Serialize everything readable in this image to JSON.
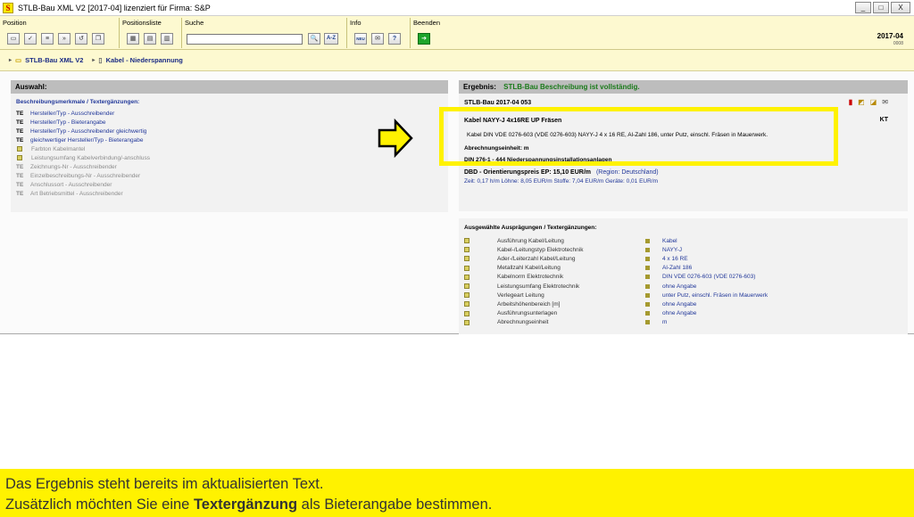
{
  "window": {
    "title": "STLB-Bau XML V2 [2017-04] lizenziert für Firma: S&P",
    "app_icon": "S",
    "buttons": [
      "_",
      "□",
      "X"
    ]
  },
  "toolbar": {
    "groups": [
      {
        "label": "Position",
        "buttons": [
          "new-doc-icon",
          "check-icon",
          "list-icon",
          "forward-icon",
          "undo-icon",
          "copy-icon"
        ]
      },
      {
        "label": "Positionsliste",
        "buttons": [
          "list-add-icon",
          "list-edit-icon",
          "list-copy-icon"
        ]
      },
      {
        "label": "Suche",
        "search_value": "",
        "binoculars": "🔍",
        "az": "A-Z"
      },
      {
        "label": "Info",
        "neu": "NEU",
        "mail": "✉",
        "help": "?"
      },
      {
        "label": "Beenden",
        "exit": "exit-icon"
      }
    ],
    "version": "2017-04",
    "version_sub": "0008"
  },
  "breadcrumb": {
    "items": [
      "STLB-Bau XML V2",
      "Kabel - Niederspannung"
    ]
  },
  "auswahl": {
    "header": "Auswahl:",
    "section_head": "Beschreibungsmerkmale / Textergänzungen:",
    "items": [
      {
        "tag": "TE",
        "text": "Hersteller/Typ - Ausschreibender",
        "muted": false
      },
      {
        "tag": "TE",
        "text": "Hersteller/Typ - Bieterangabe",
        "muted": false
      },
      {
        "tag": "TE",
        "text": "Hersteller/Typ - Ausschreibender gleichwertig",
        "muted": false
      },
      {
        "tag": "TE",
        "text": "gleichwertiger Hersteller/Typ - Bieterangabe",
        "muted": false
      },
      {
        "tag": "",
        "text": "Farbton Kabelmantel",
        "muted": true
      },
      {
        "tag": "",
        "text": "Leistungsumfang Kabelverbindung/-anschluss",
        "muted": true
      },
      {
        "tag": "TE",
        "text": "Zeichnungs-Nr - Ausschreibender",
        "muted": true
      },
      {
        "tag": "TE",
        "text": "Einzelbeschreibungs-Nr - Ausschreibender",
        "muted": true
      },
      {
        "tag": "TE",
        "text": "Anschlussort - Ausschreibender",
        "muted": true
      },
      {
        "tag": "TE",
        "text": "Art Betriebsmittel - Ausschreibender",
        "muted": true
      }
    ]
  },
  "ergebnis": {
    "label": "Ergebnis:",
    "status": "STLB-Bau Beschreibung ist vollständig.",
    "code": "STLB-Bau 2017-04 053",
    "kt": "KT",
    "kurztext": "Kabel NAYY-J 4x16RE UP Fräsen",
    "langtext": "Kabel DIN VDE 0276-603 (VDE 0276-603) NAYY-J 4 x 16 RE, Al-Zahl 186, unter Putz, einschl. Fräsen in Mauerwerk.",
    "einheit": "Abrechnungseinheit: m",
    "din": "DIN 276-1 - 444 Niederspannungsinstallationsanlagen",
    "price": "DBD - Orientierungspreis EP: 15,10 EUR/m",
    "region": "(Region: Deutschland)",
    "price_sub": "Zeit: 0,17 h/m   Löhne: 8,05 EUR/m   Stoffe: 7,04 EUR/m   Geräte: 0,01 EUR/m"
  },
  "auspraegungen": {
    "head": "Ausgewählte Ausprägungen / Textergänzungen:",
    "rows": [
      {
        "name": "Ausführung Kabel/Leitung",
        "value": "Kabel"
      },
      {
        "name": "Kabel-/Leitungstyp Elektrotechnik",
        "value": "NAYY-J"
      },
      {
        "name": "Ader-/Leiterzahl Kabel/Leitung",
        "value": "4 x 16 RE"
      },
      {
        "name": "Metallzahl Kabel/Leitung",
        "value": "Al-Zahl 186"
      },
      {
        "name": "Kabelnorm Elektrotechnik",
        "value": "DIN VDE 0276-603 (VDE 0276-603)"
      },
      {
        "name": "Leistungsumfang Elektrotechnik",
        "value": "ohne Angabe"
      },
      {
        "name": "Verlegeart Leitung",
        "value": "unter Putz, einschl. Fräsen in Mauerwerk"
      },
      {
        "name": "Arbeitshöhenbereich [m]",
        "value": "ohne Angabe"
      },
      {
        "name": "Ausführungsunterlagen",
        "value": "ohne Angabe"
      },
      {
        "name": "Abrechnungseinheit",
        "value": "m"
      }
    ]
  },
  "caption": {
    "line1": "Das Ergebnis steht bereits im aktualisierten Text.",
    "line2_pre": "Zusätzlich möchten Sie eine ",
    "line2_bold": "Textergänzung",
    "line2_post": " als Bieterangabe bestimmen."
  },
  "colors": {
    "highlight": "#fff200",
    "link_blue": "#22389a",
    "status_green": "#1a7a1a"
  }
}
